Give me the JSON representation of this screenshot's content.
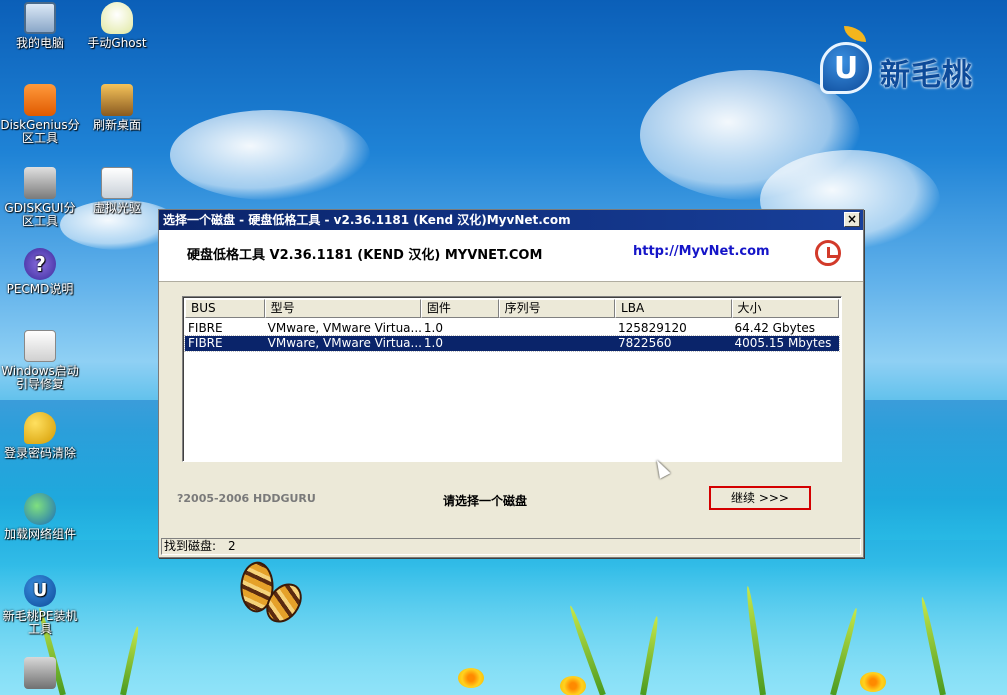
{
  "desktop": {
    "logo_text": "新毛桃",
    "logo_mark": "U",
    "icons": [
      {
        "label": "我的电脑",
        "icon": "computer-icon"
      },
      {
        "label": "手动Ghost",
        "icon": "ghost-icon"
      },
      {
        "label": "DiskGenius分区工具",
        "icon": "diskgenius-icon"
      },
      {
        "label": "刷新桌面",
        "icon": "refresh-desktop-icon"
      },
      {
        "label": "GDISKGUI分区工具",
        "icon": "gdiskgui-icon"
      },
      {
        "label": "虚拟光驱",
        "icon": "virtual-drive-icon"
      },
      {
        "label": "PECMD说明",
        "icon": "help-icon"
      },
      {
        "label": "Windows启动引导修复",
        "icon": "boot-repair-icon"
      },
      {
        "label": "登录密码清除",
        "icon": "key-icon"
      },
      {
        "label": "加载网络组件",
        "icon": "network-globe-icon"
      },
      {
        "label": "新毛桃PE装机工具",
        "icon": "installer-icon"
      }
    ]
  },
  "window": {
    "title": "选择一个磁盘 - 硬盘低格工具 - v2.36.1181 (Kend 汉化)MyvNet.com",
    "close_label": "×",
    "header_title": "硬盘低格工具 V2.36.1181 (KEND 汉化) MYVNET.COM",
    "header_link": "http://MyvNet.com",
    "columns": [
      "BUS",
      "型号",
      "固件",
      "序列号",
      "LBA",
      "大小"
    ],
    "rows": [
      {
        "bus": "FIBRE",
        "model": "VMware, VMware Virtua...",
        "firmware": "1.0",
        "serial": "",
        "lba": "125829120",
        "size": "64.42 Gbytes",
        "selected": false
      },
      {
        "bus": "FIBRE",
        "model": "VMware, VMware Virtua...",
        "firmware": "1.0",
        "serial": "",
        "lba": "7822560",
        "size": "4005.15 Mbytes",
        "selected": true
      }
    ],
    "copyright": "?2005-2006 HDDGURU",
    "prompt": "请选择一个磁盘",
    "continue_label": "继续 >>>",
    "status_label": "找到磁盘:",
    "status_count": "2"
  }
}
